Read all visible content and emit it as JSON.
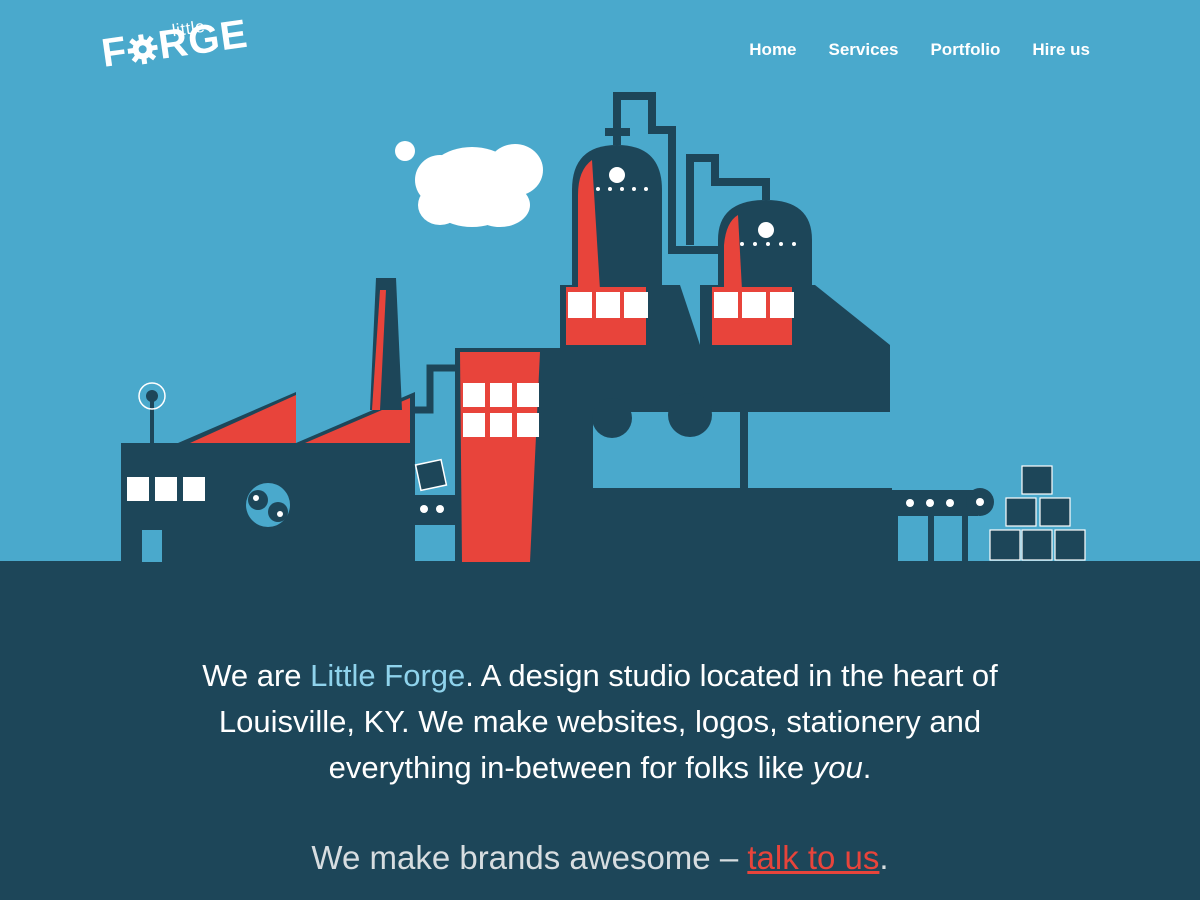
{
  "logo": {
    "small": "little",
    "big_prefix": "F",
    "big_suffix": "RGE"
  },
  "nav": {
    "items": [
      "Home",
      "Services",
      "Portfolio",
      "Hire us"
    ]
  },
  "intro": {
    "part1": "We are ",
    "highlight": "Little Forge",
    "part2": ". A design studio located in the heart of Louisville, KY. We make websites, logos, stationery and everything in-between for folks like ",
    "emphasis": "you",
    "part3": "."
  },
  "tagline": {
    "text": "We make brands awesome – ",
    "link": "talk to us",
    "end": "."
  },
  "colors": {
    "sky": "#4aa9cc",
    "ground": "#1d4659",
    "factory": "#1d4659",
    "accent_red": "#e8443b",
    "highlight_blue": "#8fd3ec",
    "white": "#ffffff"
  }
}
